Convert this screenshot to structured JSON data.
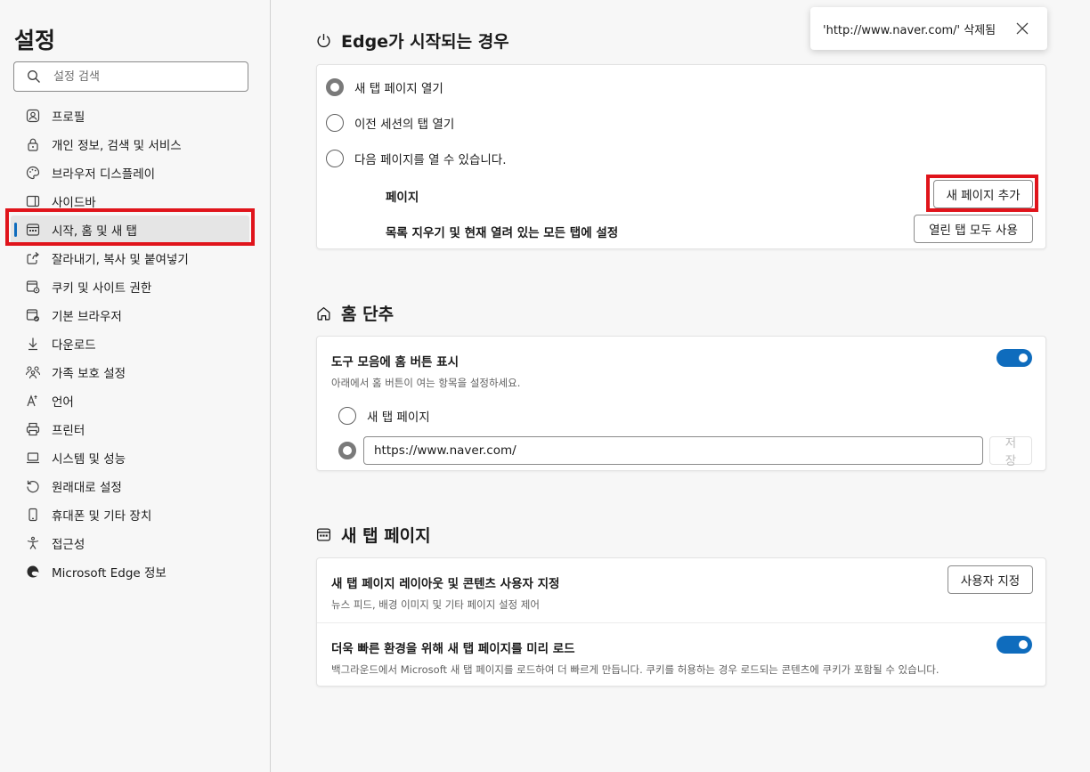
{
  "sidebar": {
    "title": "설정",
    "search_placeholder": "설정 검색",
    "items": [
      {
        "label": "프로필",
        "icon": "profile-icon"
      },
      {
        "label": "개인 정보, 검색 및 서비스",
        "icon": "lock-icon"
      },
      {
        "label": "브라우저 디스플레이",
        "icon": "palette-icon"
      },
      {
        "label": "사이드바",
        "icon": "sidebar-icon"
      },
      {
        "label": "시작, 홈 및 새 탭",
        "icon": "start-home-icon",
        "active": true
      },
      {
        "label": "잘라내기, 복사 및 붙여넣기",
        "icon": "share-icon"
      },
      {
        "label": "쿠키 및 사이트 권한",
        "icon": "cookie-icon"
      },
      {
        "label": "기본 브라우저",
        "icon": "default-browser-icon"
      },
      {
        "label": "다운로드",
        "icon": "download-icon"
      },
      {
        "label": "가족 보호 설정",
        "icon": "family-icon"
      },
      {
        "label": "언어",
        "icon": "language-icon"
      },
      {
        "label": "프린터",
        "icon": "printer-icon"
      },
      {
        "label": "시스템 및 성능",
        "icon": "system-icon"
      },
      {
        "label": "원래대로 설정",
        "icon": "reset-icon"
      },
      {
        "label": "휴대폰 및 기타 장치",
        "icon": "phone-icon"
      },
      {
        "label": "접근성",
        "icon": "accessibility-icon"
      },
      {
        "label": "Microsoft Edge 정보",
        "icon": "edge-logo-icon"
      }
    ]
  },
  "toast": {
    "message": "'http://www.naver.com/' 삭제됨"
  },
  "startup": {
    "title": "Edge가 시작되는 경우",
    "options": [
      {
        "label": "새 탭 페이지 열기",
        "checked": true
      },
      {
        "label": "이전 세션의 탭 열기",
        "checked": false
      },
      {
        "label": "다음 페이지를 열 수 있습니다.",
        "checked": false
      }
    ],
    "pages_label": "페이지",
    "add_page_button": "새 페이지 추가",
    "clear_label": "목록 지우기 및 현재 열려 있는 모든 탭에 설정",
    "use_open_tabs_button": "열린 탭 모두 사용"
  },
  "home": {
    "title": "홈 단추",
    "show_home_label": "도구 모음에 홈 버튼 표시",
    "show_home_sub": "아래에서 홈 버튼이 여는 항목을 설정하세요.",
    "show_home_enabled": true,
    "option_newtab": "새 탭 페이지",
    "url_value": "https://www.naver.com/",
    "save_button": "저장"
  },
  "newtab": {
    "title": "새 탭 페이지",
    "customize_label": "새 탭 페이지 레이아웃 및 콘텐츠 사용자 지정",
    "customize_sub": "뉴스 피드, 배경 이미지 및 기타 페이지 설정 제어",
    "customize_button": "사용자 지정",
    "preload_label": "더욱 빠른 환경을 위해 새 탭 페이지를 미리 로드",
    "preload_sub": "백그라운드에서 Microsoft 새 탭 페이지를 로드하여 더 빠르게 만듭니다. 쿠키를 허용하는 경우 로드되는 콘텐츠에 쿠키가 포함될 수 있습니다.",
    "preload_enabled": true
  },
  "colors": {
    "accent": "#0f6cbd",
    "highlight_box": "#e0141b"
  }
}
